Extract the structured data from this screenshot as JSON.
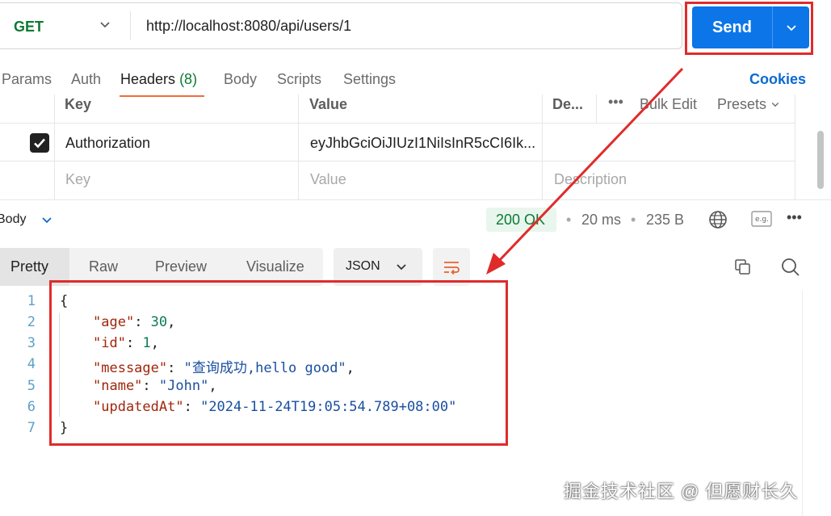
{
  "request": {
    "method": "GET",
    "url": "http://localhost:8080/api/users/1",
    "send_label": "Send"
  },
  "tabs": [
    {
      "label": "Params"
    },
    {
      "label": "Auth"
    },
    {
      "label": "Headers",
      "count": "(8)"
    },
    {
      "label": "Body"
    },
    {
      "label": "Scripts"
    },
    {
      "label": "Settings"
    }
  ],
  "cookies_label": "Cookies",
  "headers_table": {
    "columns": {
      "key": "Key",
      "value": "Value",
      "description": "De...",
      "bulk_edit": "Bulk Edit",
      "presets": "Presets"
    },
    "rows": [
      {
        "checked": true,
        "key": "Authorization",
        "value": "eyJhbGciOiJIUzI1NiIsInR5cCI6Ik..."
      }
    ],
    "placeholder": {
      "key": "Key",
      "value": "Value",
      "description": "Description"
    }
  },
  "response": {
    "section_label": "Body",
    "status": "200 OK",
    "time": "20 ms",
    "size": "235 B",
    "tabs": [
      "Pretty",
      "Raw",
      "Preview",
      "Visualize"
    ],
    "format": "JSON",
    "lines": [
      "1",
      "2",
      "3",
      "4",
      "5",
      "6",
      "7"
    ],
    "json": {
      "open": "{",
      "close": "}",
      "fields": [
        {
          "key": "\"age\"",
          "value": "30",
          "kind": "number"
        },
        {
          "key": "\"id\"",
          "value": "1",
          "kind": "number"
        },
        {
          "key": "\"message\"",
          "value": "\"查询成功,hello good\"",
          "kind": "string"
        },
        {
          "key": "\"name\"",
          "value": "\"John\"",
          "kind": "string"
        },
        {
          "key": "\"updatedAt\"",
          "value": "\"2024-11-24T19:05:54.789+08:00\"",
          "kind": "string"
        }
      ]
    }
  },
  "watermark": "掘金技术社区 @ 但愿财长久",
  "colors": {
    "accent": "#0c75e8",
    "highlight": "#e02b2b",
    "active_tab": "#f26b3a",
    "status_ok": "#0c7a33"
  }
}
